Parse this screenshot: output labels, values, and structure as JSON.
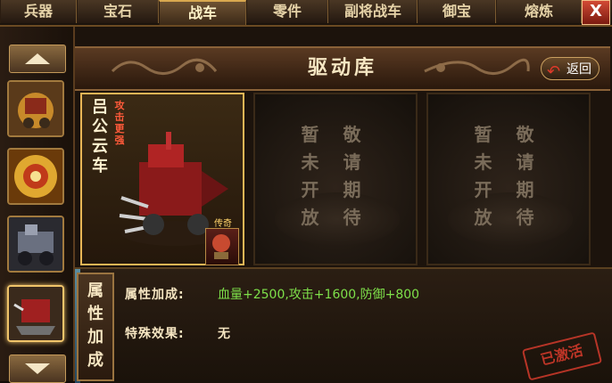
{
  "tabs": [
    {
      "label": "兵器",
      "active": false
    },
    {
      "label": "宝石",
      "active": false
    },
    {
      "label": "战车",
      "active": true
    },
    {
      "label": "零件",
      "active": false
    },
    {
      "label": "副将战车",
      "active": false
    },
    {
      "label": "御宝",
      "active": false
    },
    {
      "label": "熔炼",
      "active": false
    }
  ],
  "close_label": "X",
  "panel": {
    "title": "驱动库",
    "back_label": "返回"
  },
  "cards": {
    "active": {
      "name": "吕公云车",
      "tag": "攻击更强",
      "rarity": "传奇"
    },
    "placeholder": [
      "暂敬",
      "未请",
      "开期",
      "放待"
    ]
  },
  "bottom": {
    "section_label": "属性加成",
    "attr_label": "属性加成:",
    "attr_value": "血量+2500,攻击+1600,防御+800",
    "special_label": "特殊效果:",
    "special_value": "无",
    "stamp": "已激活"
  },
  "icons": [
    "arrow-up-icon",
    "arrow-down-icon",
    "back-arrow-icon",
    "dragon-ornament-icon"
  ],
  "colors": {
    "accent": "#e8b656",
    "attr_green": "#7ee04a",
    "stamp_red": "#d0392a"
  }
}
